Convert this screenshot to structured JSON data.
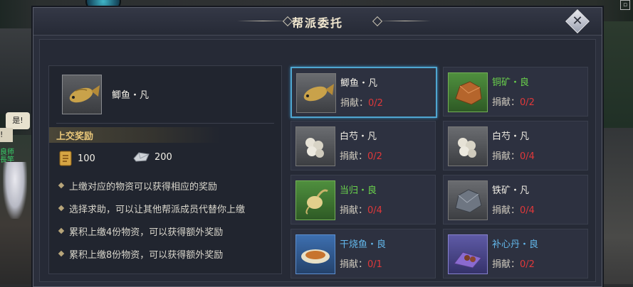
{
  "scene": {
    "npc_bubble": "是!",
    "npc_bubble2": "!",
    "npc_tag": "良师",
    "npc_tag2": "長竿"
  },
  "dialog": {
    "title": "帮派委托",
    "close_icon": "close-x-icon"
  },
  "selected_item": {
    "name": "鲫鱼・凡",
    "icon": "crucian-carp-icon"
  },
  "rewards": {
    "header": "上交奖励",
    "items": [
      {
        "icon": "contribution-scroll-icon",
        "amount": "100"
      },
      {
        "icon": "silver-ingot-icon",
        "amount": "200"
      }
    ]
  },
  "rules": [
    "上缴对应的物资可以获得相应的奖励",
    "选择求助，可以让其他帮派成员代替你上缴",
    "累积上缴4份物资，可以获得额外奖励",
    "累积上缴8份物资，可以获得额外奖励"
  ],
  "donate_label": "捐献：",
  "colors": {
    "common_text": "#f2efe6",
    "good_text": "#6bd54c",
    "rare_text": "#63b8ec",
    "progress_red": "#e0383a",
    "selected_border": "#4fa6d0"
  },
  "materials": [
    {
      "name": "鲫鱼・凡",
      "progress": "0/2",
      "quality": "common",
      "icon": "crucian-carp-icon",
      "selected": true
    },
    {
      "name": "铜矿・良",
      "progress": "0/2",
      "quality": "good",
      "icon": "copper-ore-icon",
      "selected": false
    },
    {
      "name": "白芍・凡",
      "progress": "0/2",
      "quality": "common",
      "icon": "white-peony-root-icon",
      "selected": false
    },
    {
      "name": "白芍・凡",
      "progress": "0/4",
      "quality": "common",
      "icon": "white-peony-root-icon",
      "selected": false
    },
    {
      "name": "当归・良",
      "progress": "0/4",
      "quality": "good",
      "icon": "angelica-root-icon",
      "selected": false
    },
    {
      "name": "铁矿・凡",
      "progress": "0/4",
      "quality": "common",
      "icon": "iron-ore-icon",
      "selected": false
    },
    {
      "name": "干烧鱼・良",
      "progress": "0/1",
      "quality": "rare",
      "icon": "braised-fish-dish-icon",
      "selected": false
    },
    {
      "name": "补心丹・良",
      "progress": "0/2",
      "quality": "epic",
      "icon": "heart-pill-icon",
      "selected": false
    }
  ]
}
